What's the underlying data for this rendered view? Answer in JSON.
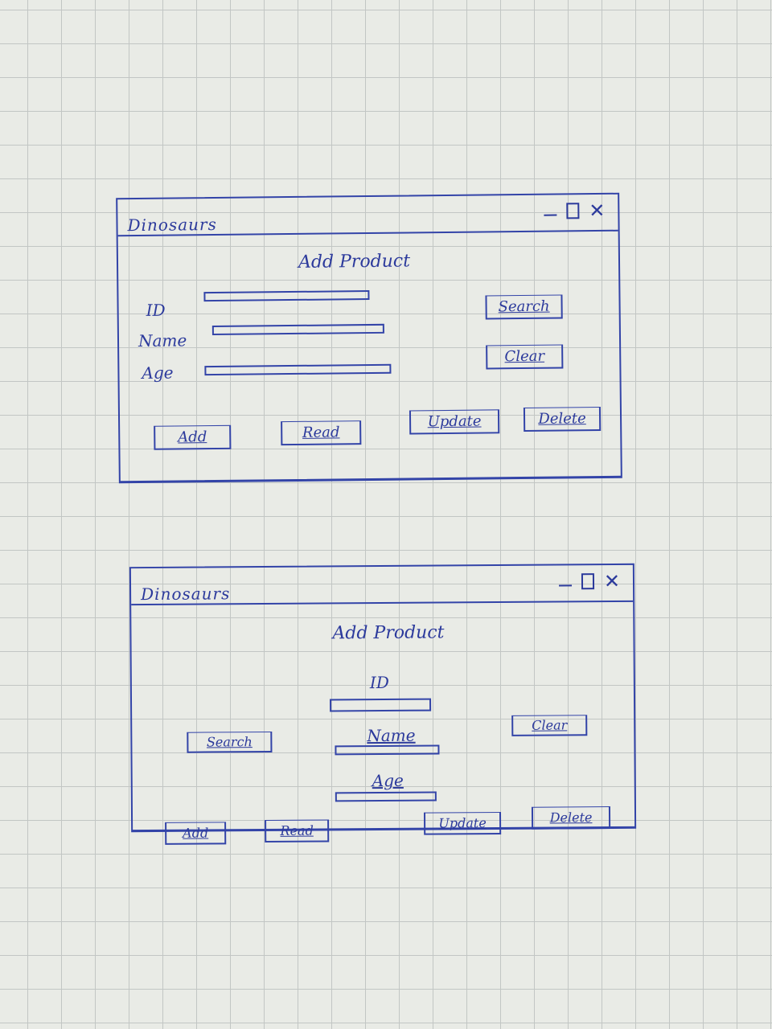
{
  "sketch1": {
    "title": "Dinosaurs",
    "heading": "Add Product",
    "labels": {
      "id": "ID",
      "name": "Name",
      "age": "Age"
    },
    "buttons": {
      "search": "Search",
      "clear": "Clear",
      "add": "Add",
      "read": "Read",
      "update": "Update",
      "delete": "Delete"
    }
  },
  "sketch2": {
    "title": "Dinosaurs",
    "heading": "Add Product",
    "labels": {
      "id": "ID",
      "name": "Name",
      "age": "Age"
    },
    "buttons": {
      "search": "Search",
      "clear": "Clear",
      "add": "Add",
      "read": "Read",
      "update": "Update",
      "delete": "Delete"
    }
  },
  "colors": {
    "ink": "#2c3a9c",
    "paper": "#e9ebe6",
    "grid": "#c2c6c4"
  }
}
